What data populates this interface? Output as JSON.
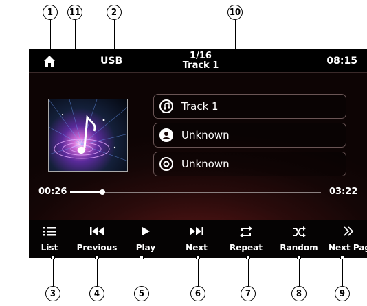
{
  "callouts": {
    "top": [
      "1",
      "11",
      "2",
      "10"
    ],
    "bottom": [
      "3",
      "4",
      "5",
      "6",
      "7",
      "8",
      "9"
    ]
  },
  "header": {
    "source": "USB",
    "track_counter": "1/16",
    "track_name": "Track 1",
    "clock": "08:15"
  },
  "info": {
    "title": "Track 1",
    "artist": "Unknown",
    "album": "Unknown"
  },
  "progress": {
    "elapsed": "00:26",
    "total": "03:22",
    "fraction": 0.13
  },
  "controls": {
    "list": "List",
    "previous": "Previous",
    "play": "Play",
    "next": "Next",
    "repeat": "Repeat",
    "random": "Random",
    "next_page": "Next Page"
  },
  "icons": {
    "home": "home-icon",
    "title": "music-note-icon",
    "artist": "person-icon",
    "album": "disc-icon"
  },
  "colors": {
    "accent": "#ffffff",
    "background": "#140606"
  }
}
